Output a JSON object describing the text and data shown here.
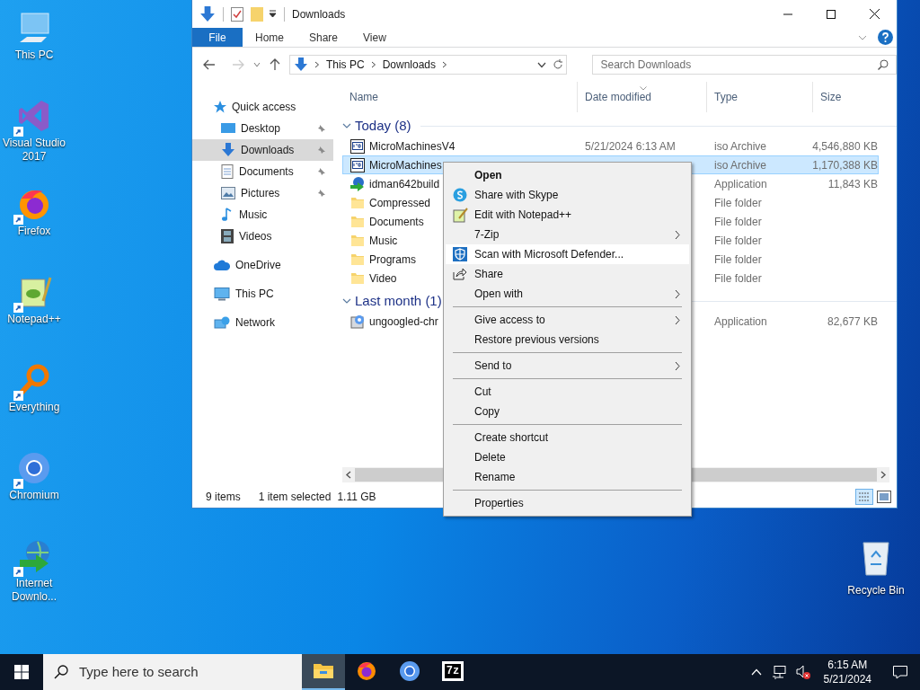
{
  "desktop_icons": [
    {
      "kind": "pc",
      "label": "This PC",
      "shortcut": false
    },
    {
      "kind": "vs",
      "label": "Visual Studio 2017",
      "shortcut": true
    },
    {
      "kind": "firefox",
      "label": "Firefox",
      "shortcut": true
    },
    {
      "kind": "notepad",
      "label": "Notepad++",
      "shortcut": true
    },
    {
      "kind": "everything",
      "label": "Everything",
      "shortcut": true
    },
    {
      "kind": "chromium",
      "label": "Chromium",
      "shortcut": true
    },
    {
      "kind": "idm",
      "label": "Internet Downlo...",
      "shortcut": true
    }
  ],
  "recycle_bin": {
    "label": "Recycle Bin"
  },
  "explorer": {
    "title": "Downloads",
    "file_tab": "File",
    "ribbon_tabs": [
      "Home",
      "Share",
      "View"
    ],
    "breadcrumbs": [
      "This PC",
      "Downloads"
    ],
    "search": {
      "placeholder": "Search Downloads"
    },
    "columns": [
      "Name",
      "Date modified",
      "Type",
      "Size"
    ],
    "sidebar": [
      {
        "kind": "star",
        "label": "Quick access",
        "selected": false,
        "children": [
          {
            "kind": "desktop",
            "label": "Desktop",
            "pinned": true,
            "selected": false
          },
          {
            "kind": "download",
            "label": "Downloads",
            "pinned": true,
            "selected": true
          },
          {
            "kind": "documents",
            "label": "Documents",
            "pinned": true,
            "selected": false
          },
          {
            "kind": "pictures",
            "label": "Pictures",
            "pinned": true,
            "selected": false
          },
          {
            "kind": "music",
            "label": "Music",
            "pinned": false,
            "selected": false
          },
          {
            "kind": "videos",
            "label": "Videos",
            "pinned": false,
            "selected": false
          }
        ]
      },
      {
        "kind": "cloud",
        "label": "OneDrive",
        "selected": false
      },
      {
        "kind": "pc",
        "label": "This PC",
        "selected": false
      },
      {
        "kind": "network",
        "label": "Network",
        "selected": false
      }
    ],
    "groups": [
      {
        "label": "Today (8)",
        "expanded": true,
        "rows": [
          {
            "kind": "iso",
            "name": "MicroMachinesV4",
            "date": "5/21/2024 6:13 AM",
            "type": "iso Archive",
            "size": "4,546,880 KB",
            "selected": false
          },
          {
            "kind": "iso",
            "name": "MicroMachines",
            "type": "iso Archive",
            "size": "1,170,388 KB",
            "selected": true
          },
          {
            "kind": "app",
            "name": "idman642build",
            "type": "Application",
            "size": "11,843 KB",
            "selected": false
          },
          {
            "kind": "folder",
            "name": "Compressed",
            "type": "File folder",
            "selected": false
          },
          {
            "kind": "folder",
            "name": "Documents",
            "type": "File folder",
            "selected": false
          },
          {
            "kind": "folder",
            "name": "Music",
            "type": "File folder",
            "selected": false
          },
          {
            "kind": "folder",
            "name": "Programs",
            "type": "File folder",
            "selected": false
          },
          {
            "kind": "folder",
            "name": "Video",
            "type": "File folder",
            "selected": false
          }
        ]
      },
      {
        "label": "Last month (1)",
        "expanded": true,
        "rows": [
          {
            "kind": "setup",
            "name": "ungoogled-chr",
            "type": "Application",
            "size": "82,677 KB",
            "selected": false
          }
        ]
      }
    ],
    "status": {
      "count": "9 items",
      "selection": "1 item selected",
      "selection_size": "1.11 GB"
    }
  },
  "context_menu": {
    "groups": [
      [
        {
          "label": "Open",
          "bold": true,
          "submenu": false,
          "highlighted": false
        },
        {
          "label": "Share with Skype",
          "bold": false,
          "submenu": false,
          "highlighted": false
        },
        {
          "label": "Edit with Notepad++",
          "bold": false,
          "submenu": false,
          "highlighted": false
        },
        {
          "label": "7-Zip",
          "bold": false,
          "submenu": true,
          "highlighted": false
        },
        {
          "label": "Scan with Microsoft Defender...",
          "bold": false,
          "submenu": false,
          "highlighted": true
        },
        {
          "label": "Share",
          "bold": false,
          "submenu": false,
          "highlighted": false
        },
        {
          "label": "Open with",
          "bold": false,
          "submenu": true,
          "highlighted": false
        }
      ],
      [
        {
          "label": "Give access to",
          "bold": false,
          "submenu": true,
          "highlighted": false
        },
        {
          "label": "Restore previous versions",
          "bold": false,
          "submenu": false,
          "highlighted": false
        }
      ],
      [
        {
          "label": "Send to",
          "bold": false,
          "submenu": true,
          "highlighted": false
        }
      ],
      [
        {
          "label": "Cut",
          "bold": false,
          "submenu": false,
          "highlighted": false
        },
        {
          "label": "Copy",
          "bold": false,
          "submenu": false,
          "highlighted": false
        }
      ],
      [
        {
          "label": "Create shortcut",
          "bold": false,
          "submenu": false,
          "highlighted": false
        },
        {
          "label": "Delete",
          "bold": false,
          "submenu": false,
          "highlighted": false
        },
        {
          "label": "Rename",
          "bold": false,
          "submenu": false,
          "highlighted": false
        }
      ],
      [
        {
          "label": "Properties",
          "bold": false,
          "submenu": false,
          "highlighted": false
        }
      ]
    ]
  },
  "taskbar": {
    "search": {
      "placeholder": "Type here to search"
    },
    "apps": [
      {
        "kind": "explorer",
        "active": true
      },
      {
        "kind": "firefox",
        "active": false
      },
      {
        "kind": "chromium",
        "active": false
      },
      {
        "kind": "sevenzip",
        "label": "7z",
        "active": false
      }
    ],
    "time": "6:15 AM",
    "date": "5/21/2024"
  }
}
